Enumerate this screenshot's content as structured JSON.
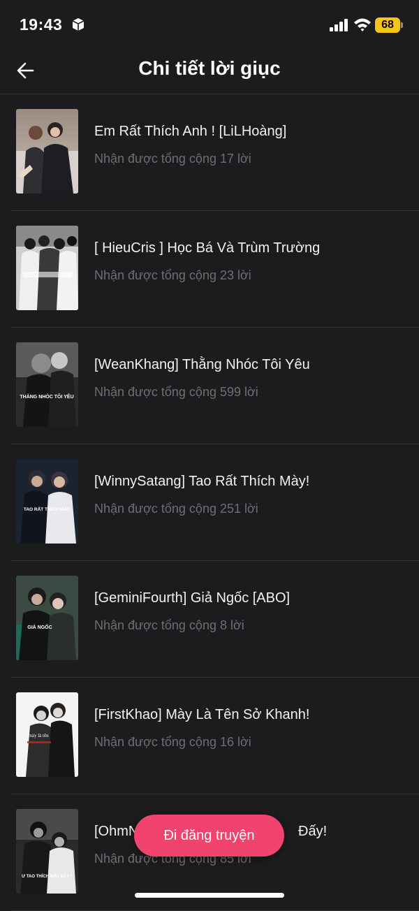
{
  "status_bar": {
    "time": "19:43",
    "battery": "68",
    "icons": [
      "box-icon",
      "signal-icon",
      "wifi-icon",
      "battery-icon"
    ]
  },
  "header": {
    "back_icon": "arrow-left-icon",
    "title": "Chi tiết lời giục"
  },
  "items": [
    {
      "title": "Em Rất Thích Anh ! [LiLHoàng]",
      "subtitle": "Nhận được tổng cộng 17 lời"
    },
    {
      "title": "[ HieuCris ] Học Bá Và Trùm Trường",
      "subtitle": "Nhận được tổng cộng 23 lời"
    },
    {
      "title": "[WeanKhang] Thằng Nhóc Tôi Yêu",
      "subtitle": "Nhận được tổng cộng 599 lời",
      "cover_text": "THẰNG NHÓC TÔI YÊU"
    },
    {
      "title": "[WinnySatang] Tao Rất Thích Mày!",
      "subtitle": "Nhận được tổng cộng 251 lời",
      "cover_text": "TAO RẤT THÍCH MÀY"
    },
    {
      "title": "[GeminiFourth] Giả Ngốc [ABO]",
      "subtitle": "Nhận được tổng cộng 8 lời",
      "cover_text": "GIẢ NGỐC"
    },
    {
      "title": "[FirstKhao] Mày Là Tên Sở Khanh!",
      "subtitle": "Nhận được tổng cộng 16 lời",
      "cover_text": "mày là tên"
    },
    {
      "title_left": "[OhmN",
      "title_right": "Đấy!",
      "subtitle": "Nhận được tổng cộng 85 lời",
      "cover_text": "Ư TAO THÍCH MÀY ĐẤY !"
    }
  ],
  "colors": {
    "background": "#1c1c1e",
    "divider": "#333335",
    "subtitle": "#6f6f73",
    "accent": "#f0446e",
    "battery": "#f5c518"
  },
  "cta": {
    "label": "Đi đăng truyện"
  }
}
